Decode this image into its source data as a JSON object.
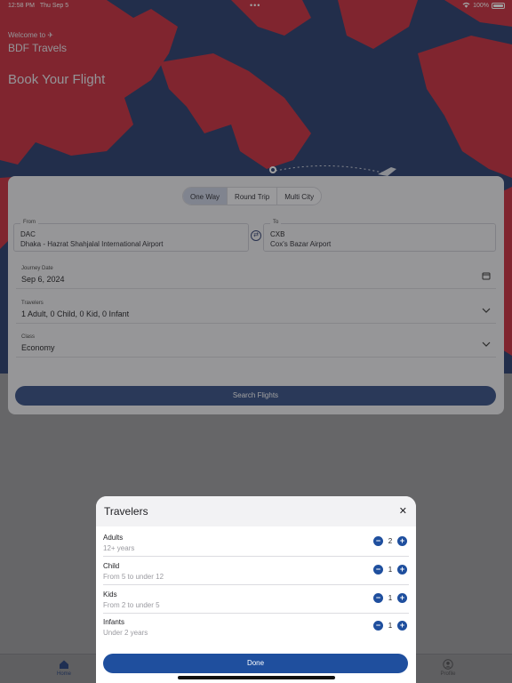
{
  "status": {
    "time": "12:58 PM",
    "date": "Thu Sep 5",
    "battery": "100%"
  },
  "header": {
    "welcome": "Welcome to ✈",
    "brand": "BDF Travels",
    "headline": "Book Your Flight"
  },
  "trip_types": [
    "One Way",
    "Round Trip",
    "Multi City"
  ],
  "active_trip_type": "One Way",
  "from": {
    "label": "From",
    "code": "DAC",
    "name": "Dhaka - Hazrat Shahjalal International Airport"
  },
  "to": {
    "label": "To",
    "code": "CXB",
    "name": "Cox's Bazar Airport"
  },
  "journey_date": {
    "label": "Journey Date",
    "value": "Sep 6, 2024"
  },
  "travelers_field": {
    "label": "Travelers",
    "value": "1 Adult, 0 Child, 0 Kid, 0 Infant"
  },
  "class_field": {
    "label": "Class",
    "value": "Economy"
  },
  "search_button": "Search Flights",
  "tabs": {
    "home": "Home",
    "profile": "Profile"
  },
  "modal": {
    "title": "Travelers",
    "rows": [
      {
        "name": "Adults",
        "sub": "12+ years",
        "value": "2"
      },
      {
        "name": "Child",
        "sub": "From 5 to under 12",
        "value": "1"
      },
      {
        "name": "Kids",
        "sub": "From 2 to under 5",
        "value": "1"
      },
      {
        "name": "Infants",
        "sub": "Under 2 years",
        "value": "1"
      }
    ],
    "done": "Done"
  },
  "colors": {
    "primary": "#1f4f9e",
    "map_land": "#c72a3b",
    "map_sea": "#25396b"
  }
}
